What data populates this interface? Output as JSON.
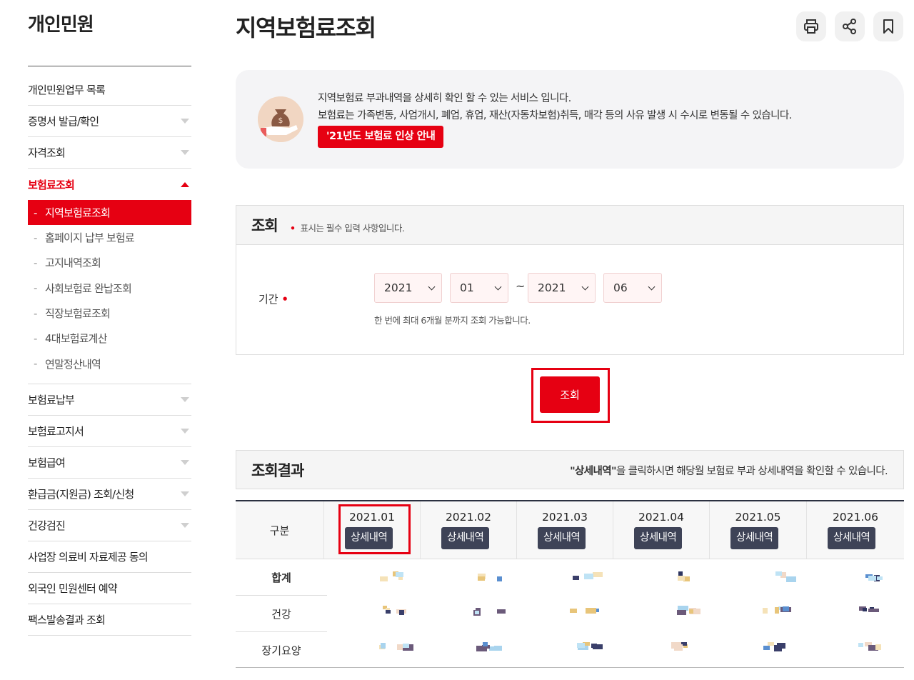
{
  "sidebar": {
    "title": "개인민원",
    "items": [
      {
        "label": "개인민원업무 목록"
      },
      {
        "label": "증명서 발급/확인"
      },
      {
        "label": "자격조회"
      },
      {
        "label": "보험료조회"
      },
      {
        "label": "보험료납부"
      },
      {
        "label": "보험료고지서"
      },
      {
        "label": "보험급여"
      },
      {
        "label": "환급금(지원금) 조회/신청"
      },
      {
        "label": "건강검진"
      },
      {
        "label": "사업장 의료비 자료제공 동의"
      },
      {
        "label": "외국인 민원센터 예약"
      },
      {
        "label": "팩스발송결과 조회"
      }
    ],
    "sub_items": [
      {
        "label": "지역보험료조회"
      },
      {
        "label": "홈페이지 납부 보험료"
      },
      {
        "label": "고지내역조회"
      },
      {
        "label": "사회보험료 완납조회"
      },
      {
        "label": "직장보험료조회"
      },
      {
        "label": "4대보험료계산"
      },
      {
        "label": "연말정산내역"
      }
    ],
    "dash": "-"
  },
  "page": {
    "title": "지역보험료조회"
  },
  "info": {
    "line1": "지역보험료 부과내역을 상세히 확인 할 수 있는 서비스 입니다.",
    "line2": "보험료는 가족변동, 사업개시, 폐업, 휴업, 재산(자동차보험)취득, 매각 등의 사유 발생 시 수시로 변동될 수 있습니다.",
    "notice_button": "'21년도 보험료 인상 안내"
  },
  "search": {
    "heading": "조회",
    "required_dot": "•",
    "required_note": "표시는 필수 입력 사항입니다.",
    "period_label": "기간",
    "start_year": "2021",
    "start_month": "01",
    "tilde": "~",
    "end_year": "2021",
    "end_month": "06",
    "helper": "한 번에 최대 6개월 분까지 조회 가능합니다.",
    "submit": "조회"
  },
  "result": {
    "heading": "조회결과",
    "note_bold": "\"상세내역\"",
    "note_rest": "을 클릭하시면 해당월 보험료 부과 상세내역을 확인할 수 있습니다.",
    "col_header": "구분",
    "detail_button": "상세내역",
    "months": [
      "2021.01",
      "2021.02",
      "2021.03",
      "2021.04",
      "2021.05",
      "2021.06"
    ],
    "rows": [
      {
        "label": "합계"
      },
      {
        "label": "건강"
      },
      {
        "label": "장기요양"
      }
    ]
  },
  "colors": {
    "accent": "#e60012",
    "dark_button": "#3e4357"
  }
}
